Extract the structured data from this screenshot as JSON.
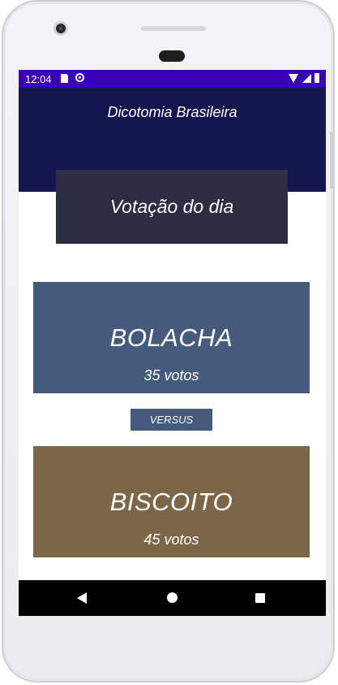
{
  "status_bar": {
    "time": "12:04",
    "icons": [
      "sd-card-icon",
      "sync-icon",
      "wifi-icon",
      "signal-icon",
      "battery-icon"
    ]
  },
  "app_bar": {
    "title": "Dicotomia Brasileira"
  },
  "daily_vote": {
    "label": "Votação do dia"
  },
  "option_a": {
    "name": "BOLACHA",
    "votes": "35 votos",
    "color": "#465a7c"
  },
  "versus": {
    "label": "VERSUS"
  },
  "option_b": {
    "name": "BISCOITO",
    "votes": "45 votos",
    "color": "#7c6648"
  },
  "colors": {
    "status_bar": "#3a00b8",
    "app_bar": "#15154f",
    "daily_box": "#2d2d45"
  },
  "nav_bar": {
    "icons": [
      "back-icon",
      "home-icon",
      "recents-icon"
    ]
  }
}
